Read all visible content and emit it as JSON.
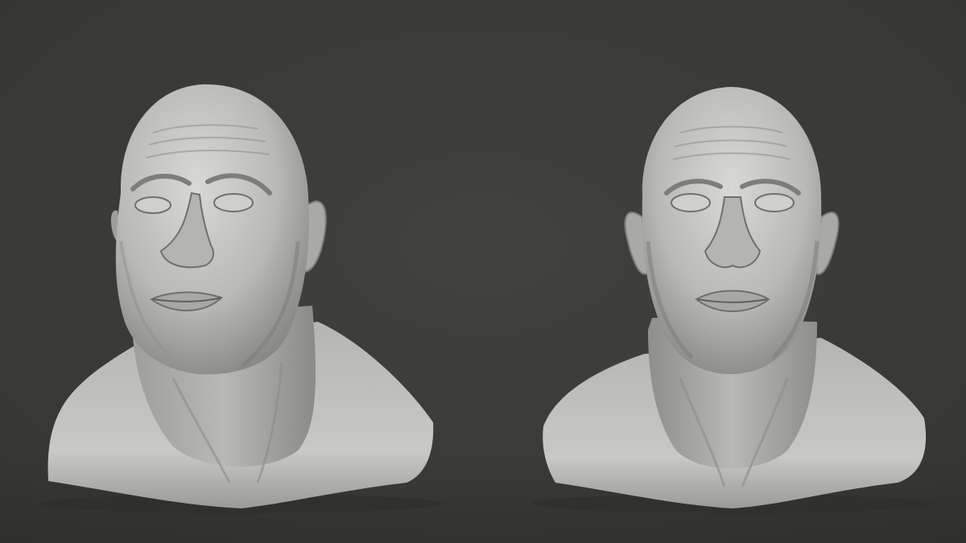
{
  "scene": {
    "description_free": true,
    "background_color": "#3a3b37",
    "material_color": "#c9c9c6",
    "views": [
      {
        "name": "three-quarter-view"
      },
      {
        "name": "front-view"
      }
    ]
  }
}
